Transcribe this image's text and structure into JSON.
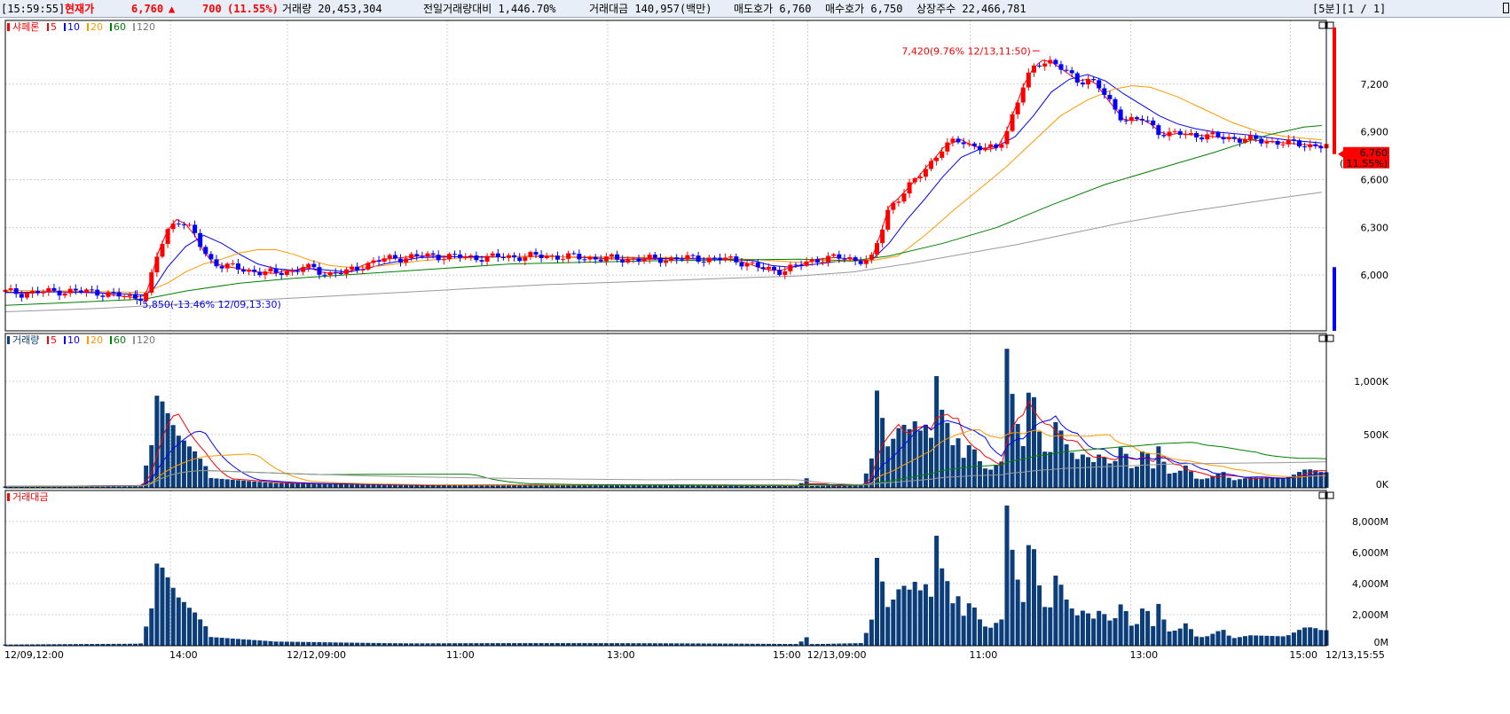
{
  "header": {
    "time": "[15:59:55]",
    "current_label": "현재가",
    "price": "6,760",
    "arrow": "▲",
    "change": "700",
    "change_pct": "(11.55%)",
    "volume": "거래량 20,453,304",
    "prev_vol_ratio": "전일거래량대비 1,446.70%",
    "amount": "거래대금 140,957(백만)",
    "ask": "매도호가 6,760",
    "bid": "매수호가 6,750",
    "shares": "상장주수 22,466,781",
    "period": "[5분][1 / 1]"
  },
  "colors": {
    "up": "#ff0000",
    "down": "#0000ff",
    "ma5": "#ff0000",
    "ma10": "#0000ff",
    "ma20": "#ff9900",
    "ma60": "#008000",
    "ma120": "#999999",
    "volbar": "#0a3d7a",
    "grid": "#d0d0d0"
  },
  "chart_data": [
    {
      "type": "candlestick",
      "title": "샤페론",
      "legend": [
        "5",
        "10",
        "20",
        "60",
        "120"
      ],
      "ylim": [
        5650,
        7600
      ],
      "yticks": [
        6000,
        6300,
        6600,
        6900,
        7200
      ],
      "ytick_labels": [
        "6,000",
        "6,300",
        "6,600",
        "6,900",
        "7,200"
      ],
      "current_price": "6,760",
      "current_pct": "( 11.55%)",
      "annotations": {
        "high": "7,420(9.76% 12/13,11:50)",
        "low": "5,850(-13.46% 12/09,13:30)"
      },
      "ma": {
        "ma5": [
          [
            0,
            5895
          ],
          [
            20,
            5885
          ],
          [
            60,
            5900
          ],
          [
            100,
            5895
          ],
          [
            120,
            5875
          ],
          [
            140,
            5860
          ],
          [
            155,
            5870
          ],
          [
            160,
            5950
          ],
          [
            170,
            6150
          ],
          [
            180,
            6280
          ],
          [
            190,
            6350
          ],
          [
            200,
            6320
          ],
          [
            210,
            6250
          ],
          [
            220,
            6150
          ],
          [
            230,
            6080
          ],
          [
            240,
            6060
          ],
          [
            250,
            6050
          ],
          [
            260,
            6040
          ],
          [
            280,
            6020
          ],
          [
            300,
            6010
          ],
          [
            310,
            6030
          ],
          [
            320,
            6020
          ],
          [
            330,
            6050
          ],
          [
            340,
            6040
          ],
          [
            350,
            6020
          ],
          [
            360,
            6010
          ],
          [
            380,
            6020
          ],
          [
            400,
            6070
          ],
          [
            420,
            6100
          ],
          [
            440,
            6110
          ],
          [
            460,
            6120
          ],
          [
            480,
            6120
          ],
          [
            500,
            6115
          ],
          [
            520,
            6110
          ],
          [
            560,
            6115
          ],
          [
            600,
            6120
          ],
          [
            640,
            6110
          ],
          [
            680,
            6100
          ],
          [
            720,
            6100
          ],
          [
            760,
            6105
          ],
          [
            800,
            6100
          ],
          [
            820,
            6080
          ],
          [
            840,
            6040
          ],
          [
            850,
            6030
          ],
          [
            860,
            6030
          ],
          [
            880,
            6060
          ],
          [
            900,
            6100
          ],
          [
            920,
            6110
          ],
          [
            940,
            6100
          ],
          [
            960,
            6090
          ],
          [
            970,
            6250
          ],
          [
            980,
            6430
          ],
          [
            990,
            6480
          ],
          [
            1000,
            6540
          ],
          [
            1010,
            6600
          ],
          [
            1020,
            6670
          ],
          [
            1030,
            6730
          ],
          [
            1040,
            6800
          ],
          [
            1050,
            6830
          ],
          [
            1060,
            6850
          ],
          [
            1070,
            6820
          ],
          [
            1080,
            6800
          ],
          [
            1090,
            6790
          ],
          [
            1100,
            6800
          ],
          [
            1110,
            6900
          ],
          [
            1120,
            7050
          ],
          [
            1130,
            7200
          ],
          [
            1140,
            7300
          ],
          [
            1150,
            7350
          ],
          [
            1160,
            7340
          ],
          [
            1170,
            7300
          ],
          [
            1180,
            7260
          ],
          [
            1190,
            7220
          ],
          [
            1200,
            7230
          ],
          [
            1210,
            7200
          ],
          [
            1220,
            7120
          ],
          [
            1230,
            7050
          ],
          [
            1240,
            6980
          ],
          [
            1250,
            6970
          ],
          [
            1260,
            6980
          ],
          [
            1270,
            6950
          ],
          [
            1280,
            6900
          ],
          [
            1290,
            6880
          ],
          [
            1300,
            6890
          ],
          [
            1320,
            6880
          ],
          [
            1340,
            6870
          ],
          [
            1360,
            6860
          ],
          [
            1380,
            6850
          ],
          [
            1400,
            6840
          ],
          [
            1420,
            6830
          ],
          [
            1440,
            6820
          ],
          [
            1460,
            6810
          ]
        ],
        "ma10": [
          [
            0,
            5890
          ],
          [
            60,
            5895
          ],
          [
            120,
            5885
          ],
          [
            155,
            5875
          ],
          [
            165,
            5920
          ],
          [
            180,
            6050
          ],
          [
            200,
            6180
          ],
          [
            220,
            6250
          ],
          [
            240,
            6200
          ],
          [
            260,
            6130
          ],
          [
            280,
            6070
          ],
          [
            300,
            6040
          ],
          [
            320,
            6030
          ],
          [
            340,
            6040
          ],
          [
            360,
            6030
          ],
          [
            380,
            6020
          ],
          [
            400,
            6040
          ],
          [
            420,
            6070
          ],
          [
            440,
            6090
          ],
          [
            460,
            6110
          ],
          [
            500,
            6115
          ],
          [
            560,
            6115
          ],
          [
            640,
            6115
          ],
          [
            720,
            6105
          ],
          [
            800,
            6100
          ],
          [
            830,
            6090
          ],
          [
            850,
            6060
          ],
          [
            870,
            6050
          ],
          [
            900,
            6070
          ],
          [
            930,
            6090
          ],
          [
            960,
            6090
          ],
          [
            980,
            6200
          ],
          [
            1000,
            6350
          ],
          [
            1020,
            6480
          ],
          [
            1040,
            6620
          ],
          [
            1060,
            6740
          ],
          [
            1080,
            6790
          ],
          [
            1100,
            6810
          ],
          [
            1120,
            6870
          ],
          [
            1140,
            7000
          ],
          [
            1160,
            7150
          ],
          [
            1180,
            7230
          ],
          [
            1200,
            7260
          ],
          [
            1220,
            7220
          ],
          [
            1240,
            7140
          ],
          [
            1260,
            7070
          ],
          [
            1280,
            7000
          ],
          [
            1300,
            6950
          ],
          [
            1320,
            6920
          ],
          [
            1340,
            6900
          ],
          [
            1380,
            6880
          ],
          [
            1420,
            6850
          ],
          [
            1460,
            6830
          ]
        ],
        "ma20": [
          [
            0,
            5905
          ],
          [
            60,
            5900
          ],
          [
            120,
            5895
          ],
          [
            155,
            5890
          ],
          [
            180,
            5950
          ],
          [
            200,
            6020
          ],
          [
            220,
            6070
          ],
          [
            240,
            6100
          ],
          [
            260,
            6140
          ],
          [
            280,
            6160
          ],
          [
            300,
            6160
          ],
          [
            320,
            6130
          ],
          [
            340,
            6090
          ],
          [
            360,
            6060
          ],
          [
            380,
            6050
          ],
          [
            400,
            6050
          ],
          [
            420,
            6060
          ],
          [
            440,
            6075
          ],
          [
            460,
            6090
          ],
          [
            500,
            6105
          ],
          [
            560,
            6115
          ],
          [
            640,
            6115
          ],
          [
            720,
            6110
          ],
          [
            800,
            6105
          ],
          [
            840,
            6095
          ],
          [
            880,
            6080
          ],
          [
            920,
            6085
          ],
          [
            960,
            6090
          ],
          [
            990,
            6120
          ],
          [
            1020,
            6250
          ],
          [
            1050,
            6400
          ],
          [
            1080,
            6540
          ],
          [
            1110,
            6680
          ],
          [
            1140,
            6840
          ],
          [
            1170,
            7000
          ],
          [
            1200,
            7100
          ],
          [
            1230,
            7170
          ],
          [
            1250,
            7190
          ],
          [
            1270,
            7180
          ],
          [
            1300,
            7120
          ],
          [
            1330,
            7040
          ],
          [
            1360,
            6960
          ],
          [
            1390,
            6900
          ],
          [
            1420,
            6870
          ],
          [
            1460,
            6850
          ]
        ],
        "ma60": [
          [
            0,
            5810
          ],
          [
            80,
            5830
          ],
          [
            155,
            5850
          ],
          [
            200,
            5900
          ],
          [
            260,
            5950
          ],
          [
            320,
            5980
          ],
          [
            400,
            6010
          ],
          [
            480,
            6040
          ],
          [
            560,
            6070
          ],
          [
            640,
            6080
          ],
          [
            720,
            6090
          ],
          [
            800,
            6095
          ],
          [
            880,
            6100
          ],
          [
            940,
            6090
          ],
          [
            980,
            6120
          ],
          [
            1040,
            6200
          ],
          [
            1100,
            6300
          ],
          [
            1160,
            6440
          ],
          [
            1220,
            6570
          ],
          [
            1280,
            6670
          ],
          [
            1340,
            6770
          ],
          [
            1400,
            6880
          ],
          [
            1440,
            6930
          ],
          [
            1460,
            6940
          ]
        ],
        "ma120": [
          [
            0,
            5770
          ],
          [
            100,
            5790
          ],
          [
            200,
            5820
          ],
          [
            300,
            5850
          ],
          [
            400,
            5880
          ],
          [
            500,
            5910
          ],
          [
            600,
            5940
          ],
          [
            700,
            5960
          ],
          [
            800,
            5980
          ],
          [
            880,
            5995
          ],
          [
            940,
            6020
          ],
          [
            1000,
            6070
          ],
          [
            1060,
            6130
          ],
          [
            1120,
            6190
          ],
          [
            1180,
            6260
          ],
          [
            1240,
            6330
          ],
          [
            1300,
            6390
          ],
          [
            1360,
            6440
          ],
          [
            1420,
            6490
          ],
          [
            1460,
            6520
          ]
        ]
      }
    },
    {
      "type": "bar",
      "title": "거래량",
      "legend": [
        "5",
        "10",
        "20",
        "60",
        "120"
      ],
      "ylim": [
        0,
        1450000
      ],
      "yticks": [
        0,
        500000,
        1000000
      ],
      "ytick_labels": [
        "0K",
        "500K",
        "1,000K"
      ]
    },
    {
      "type": "bar",
      "title": "거래대금",
      "ylim": [
        0,
        10000
      ],
      "yticks": [
        0,
        2000,
        4000,
        6000,
        8000
      ],
      "ytick_labels": [
        "0M",
        "2,000M",
        "4,000M",
        "6,000M",
        "8,000M"
      ]
    }
  ],
  "xaxis": {
    "labels": [
      "12/09,12:00",
      "14:00",
      "12/12,09:00",
      "11:00",
      "13:00",
      "15:00",
      "12/13,09:00",
      "11:00",
      "13:00",
      "15:00",
      "12/13,15:55"
    ],
    "positions": [
      0,
      183,
      313,
      490,
      668,
      852,
      890,
      1070,
      1248,
      1425,
      1465
    ]
  },
  "volume_anchors": [
    [
      0,
      15
    ],
    [
      150,
      20
    ],
    [
      162,
      350
    ],
    [
      168,
      770
    ],
    [
      174,
      720
    ],
    [
      180,
      620
    ],
    [
      186,
      520
    ],
    [
      192,
      430
    ],
    [
      198,
      390
    ],
    [
      204,
      340
    ],
    [
      210,
      300
    ],
    [
      216,
      240
    ],
    [
      222,
      180
    ],
    [
      228,
      80
    ],
    [
      300,
      40
    ],
    [
      420,
      30
    ],
    [
      600,
      25
    ],
    [
      880,
      20
    ],
    [
      888,
      110
    ],
    [
      894,
      20
    ],
    [
      950,
      30
    ],
    [
      962,
      320
    ],
    [
      968,
      1120
    ],
    [
      974,
      540
    ],
    [
      980,
      350
    ],
    [
      986,
      490
    ],
    [
      992,
      570
    ],
    [
      998,
      580
    ],
    [
      1004,
      520
    ],
    [
      1010,
      620
    ],
    [
      1016,
      480
    ],
    [
      1022,
      580
    ],
    [
      1028,
      400
    ],
    [
      1034,
      1130
    ],
    [
      1040,
      550
    ],
    [
      1046,
      560
    ],
    [
      1052,
      310
    ],
    [
      1058,
      450
    ],
    [
      1064,
      200
    ],
    [
      1070,
      400
    ],
    [
      1076,
      300
    ],
    [
      1082,
      200
    ],
    [
      1088,
      150
    ],
    [
      1094,
      150
    ],
    [
      1100,
      200
    ],
    [
      1106,
      220
    ],
    [
      1112,
      1380
    ],
    [
      1118,
      610
    ],
    [
      1124,
      500
    ],
    [
      1130,
      300
    ],
    [
      1136,
      900
    ],
    [
      1142,
      700
    ],
    [
      1148,
      400
    ],
    [
      1154,
      270
    ],
    [
      1160,
      300
    ],
    [
      1166,
      600
    ],
    [
      1172,
      440
    ],
    [
      1178,
      340
    ],
    [
      1184,
      280
    ],
    [
      1190,
      230
    ],
    [
      1196,
      290
    ],
    [
      1202,
      250
    ],
    [
      1208,
      210
    ],
    [
      1214,
      300
    ],
    [
      1220,
      250
    ],
    [
      1226,
      200
    ],
    [
      1232,
      240
    ],
    [
      1238,
      380
    ],
    [
      1244,
      280
    ],
    [
      1250,
      150
    ],
    [
      1256,
      200
    ],
    [
      1262,
      360
    ],
    [
      1268,
      300
    ],
    [
      1274,
      150
    ],
    [
      1280,
      440
    ],
    [
      1286,
      200
    ],
    [
      1292,
      120
    ],
    [
      1298,
      150
    ],
    [
      1304,
      170
    ],
    [
      1310,
      230
    ],
    [
      1316,
      150
    ],
    [
      1322,
      80
    ],
    [
      1328,
      90
    ],
    [
      1334,
      100
    ],
    [
      1340,
      130
    ],
    [
      1350,
      180
    ],
    [
      1360,
      80
    ],
    [
      1380,
      110
    ],
    [
      1400,
      100
    ],
    [
      1420,
      90
    ],
    [
      1440,
      170
    ],
    [
      1450,
      170
    ],
    [
      1460,
      140
    ]
  ]
}
